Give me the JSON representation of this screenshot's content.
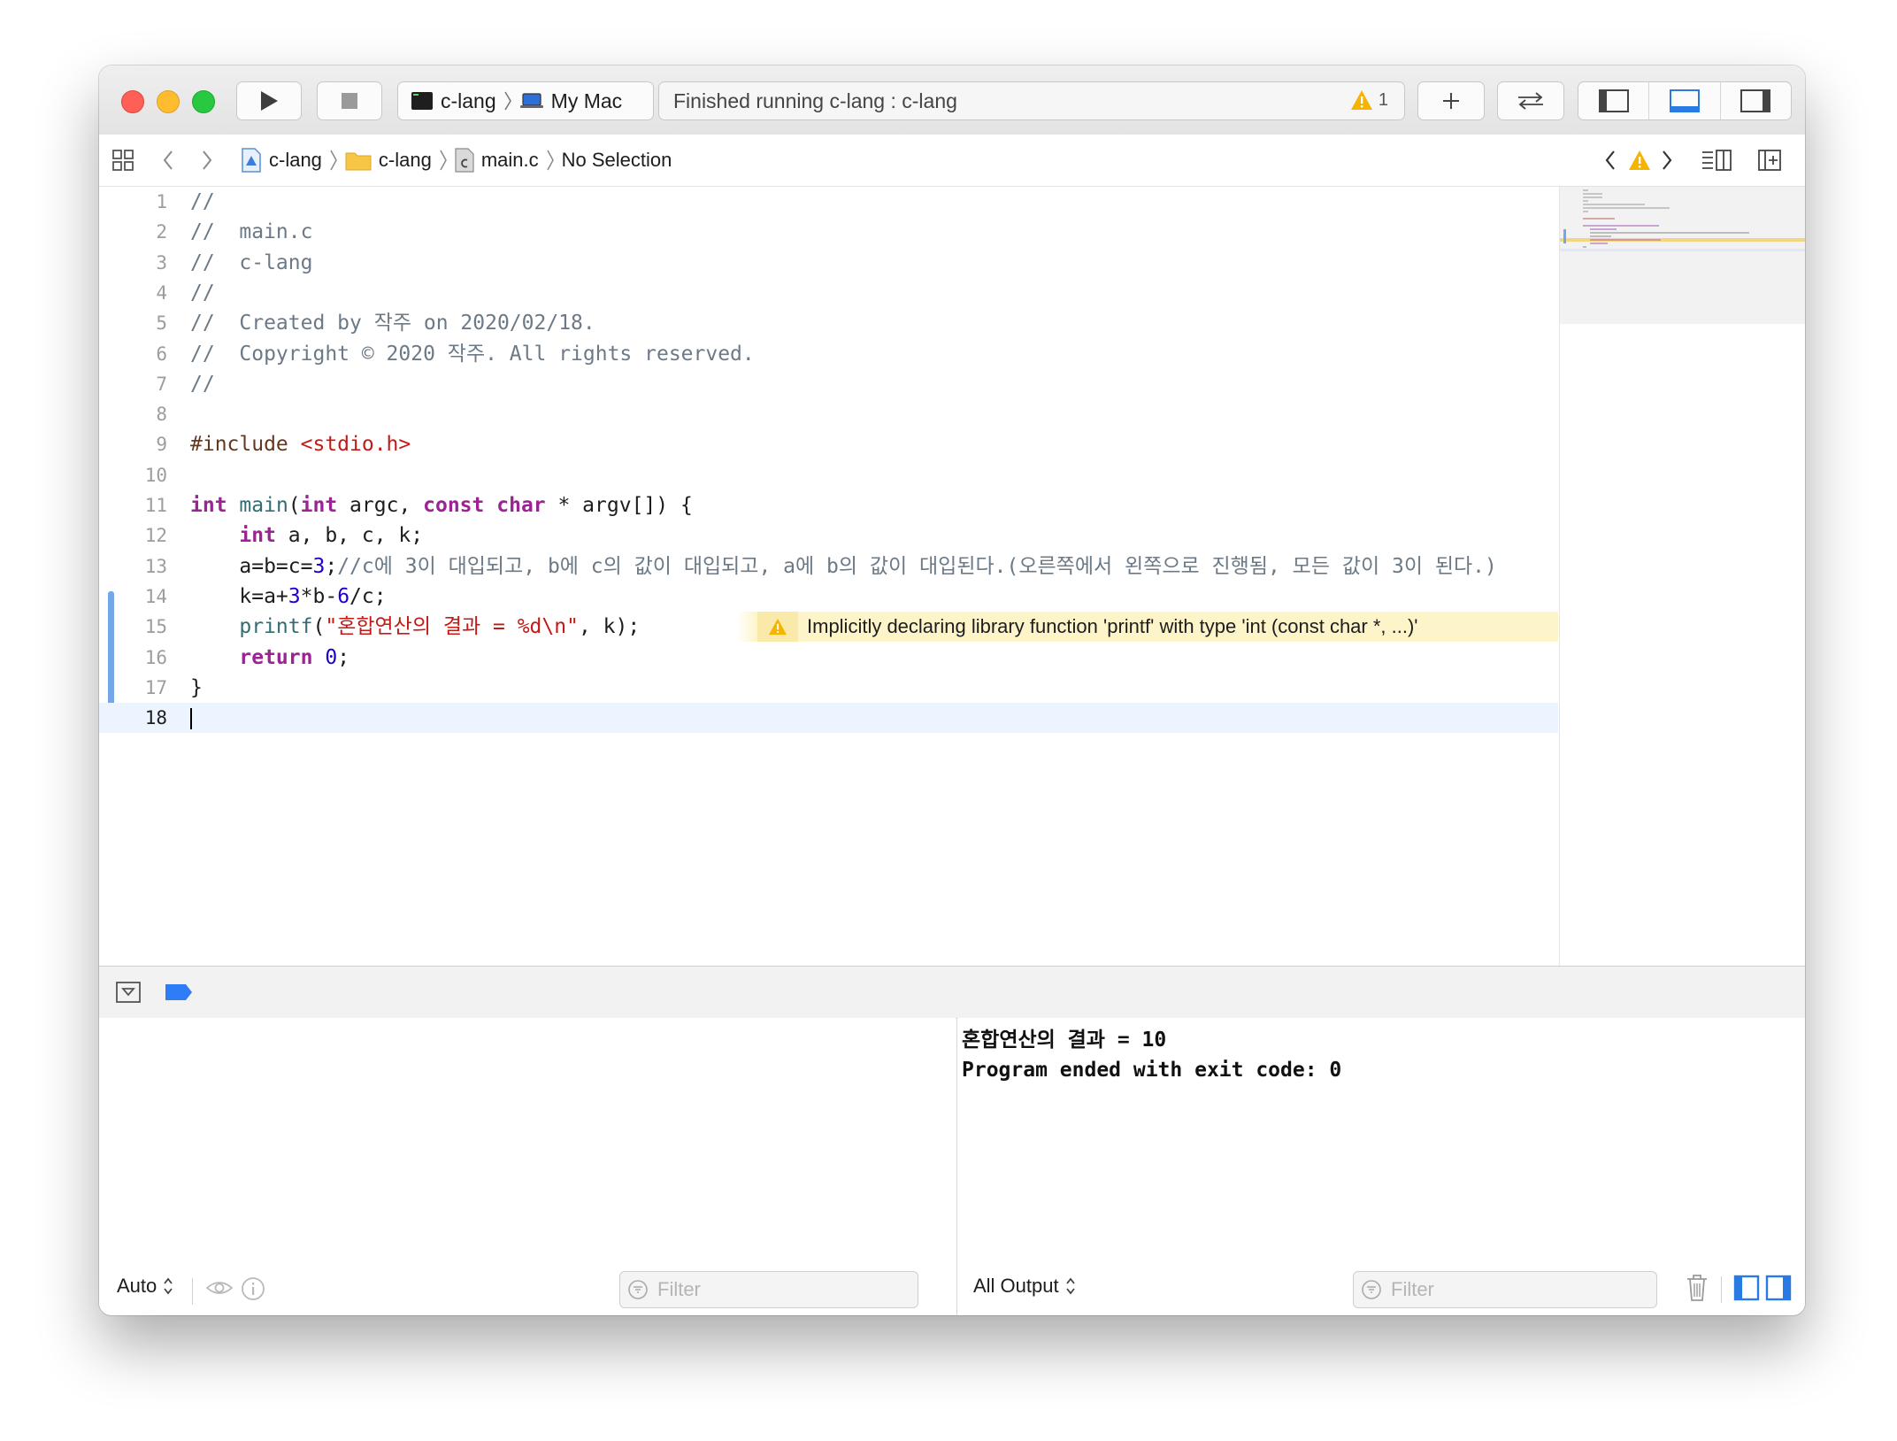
{
  "toolbar": {
    "scheme": "c-lang",
    "destination": "My Mac",
    "activity_status": "Finished running c-lang : c-lang",
    "warning_count": "1"
  },
  "jumpbar": {
    "project": "c-lang",
    "group": "c-lang",
    "file": "main.c",
    "symbol": "No Selection"
  },
  "editor": {
    "current_line": 18,
    "warning": {
      "line": 15,
      "message": "Implicitly declaring library function 'printf' with type 'int (const char *, ...)'"
    },
    "lines": [
      {
        "n": "1",
        "text": "//"
      },
      {
        "n": "2",
        "text": "//  main.c"
      },
      {
        "n": "3",
        "text": "//  c-lang"
      },
      {
        "n": "4",
        "text": "//"
      },
      {
        "n": "5",
        "text": "//  Created by 작주 on 2020/02/18."
      },
      {
        "n": "6",
        "text": "//  Copyright © 2020 작주. All rights reserved."
      },
      {
        "n": "7",
        "text": "//"
      },
      {
        "n": "8",
        "text": ""
      },
      {
        "n": "9",
        "text": "#include <stdio.h>"
      },
      {
        "n": "10",
        "text": ""
      },
      {
        "n": "11",
        "text": "int main(int argc, const char * argv[]) {"
      },
      {
        "n": "12",
        "text": "    int a, b, c, k;"
      },
      {
        "n": "13",
        "text": "    a=b=c=3;//c에 3이 대입되고, b에 c의 값이 대입되고, a에 b의 값이 대입된다.(오른쪽에서 왼쪽으로 진행됨, 모든 값이 3이 된다.)"
      },
      {
        "n": "14",
        "text": "    k=a+3*b-6/c;"
      },
      {
        "n": "15",
        "text": "    printf(\"혼합연산의 결과 = %d\\n\", k);"
      },
      {
        "n": "16",
        "text": "    return 0;"
      },
      {
        "n": "17",
        "text": "}"
      },
      {
        "n": "18",
        "text": ""
      }
    ]
  },
  "debug": {
    "variables_scope": "Auto",
    "variables_filter_placeholder": "Filter",
    "console_scope": "All Output",
    "console_filter_placeholder": "Filter",
    "console_output": [
      "혼합연산의 결과 = 10",
      "Program ended with exit code: 0"
    ]
  },
  "colors": {
    "accent": "#3b82f6",
    "warning_bg": "#fdf5c9",
    "current_line_bg": "#ecf5ff"
  }
}
